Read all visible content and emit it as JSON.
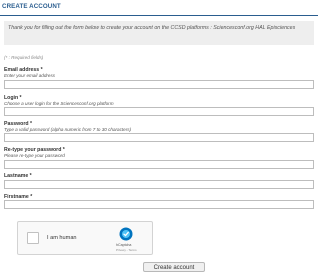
{
  "page": {
    "title": "CREATE ACCOUNT",
    "intro": "Thank you for filling out the form below to create your account on the CCSD platforms : Sciencesconf.org HAL Episciences",
    "required_note": "(* : Required fields)"
  },
  "form": {
    "email": {
      "label": "Email address *",
      "hint": "Enter your email address",
      "value": ""
    },
    "login": {
      "label": "Login *",
      "hint": "Choose a user login for the Sciencesconf.org platform",
      "value": ""
    },
    "password": {
      "label": "Password *",
      "hint": "Type a valid password (alpha numeric from 7 to 30 characters)",
      "value": ""
    },
    "retype_password": {
      "label": "Re-type your password *",
      "hint": "Please re-type your password",
      "value": ""
    },
    "lastname": {
      "label": "Lastname *",
      "value": ""
    },
    "firstname": {
      "label": "Firstname *",
      "value": ""
    }
  },
  "captcha": {
    "label": "I am human",
    "brand": "hCaptcha",
    "links": "Privacy - Terms",
    "logo_icon": "hcaptcha-logo-icon",
    "logo_color": "#0074bf",
    "checked": false
  },
  "submit": {
    "label": "Create account"
  },
  "colors": {
    "title": "#2a5d8f",
    "intro_bg": "#eeeeee"
  }
}
